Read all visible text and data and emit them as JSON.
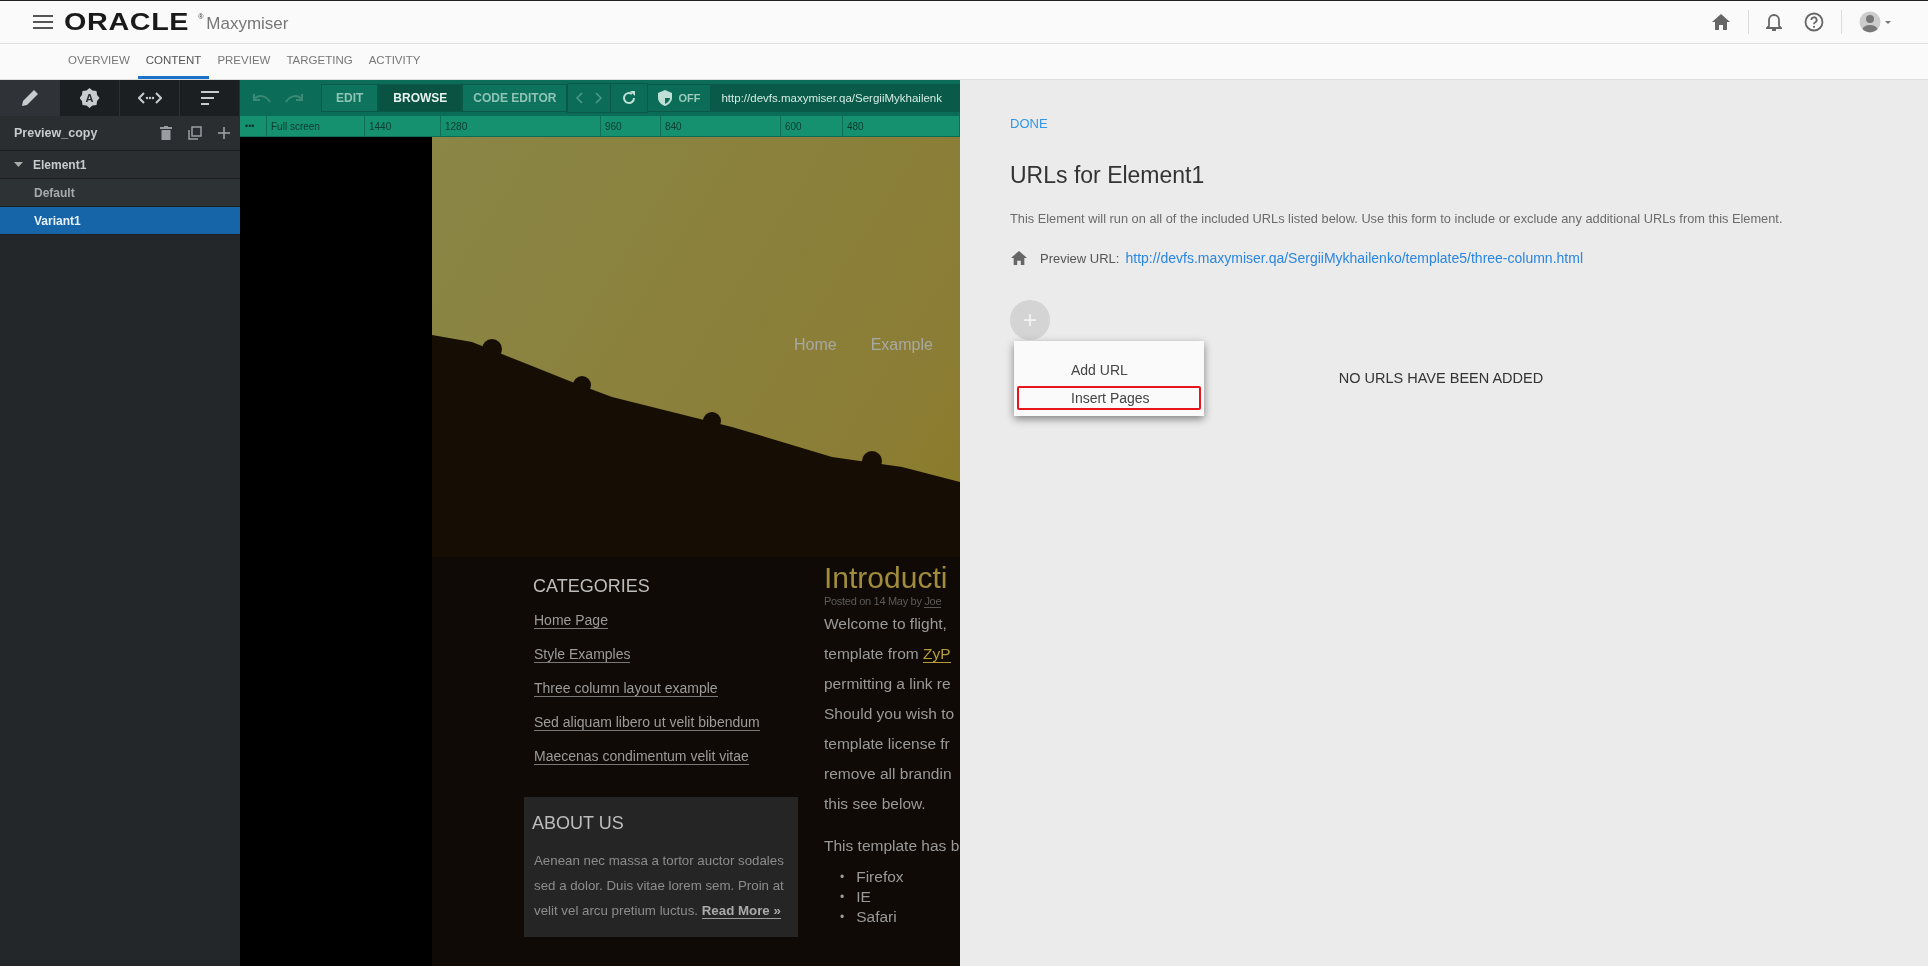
{
  "header": {
    "logo": "ORACLE",
    "logo_mark": "®",
    "product": "Maxymiser"
  },
  "nav_tabs": [
    {
      "label": "OVERVIEW",
      "selected": false
    },
    {
      "label": "CONTENT",
      "selected": true
    },
    {
      "label": "PREVIEW",
      "selected": false
    },
    {
      "label": "TARGETING",
      "selected": false
    },
    {
      "label": "ACTIVITY",
      "selected": false
    }
  ],
  "sidebar": {
    "tabs": [
      {
        "kind": "pencil",
        "selected": true
      },
      {
        "kind": "badge",
        "glyph": "A",
        "selected": false
      },
      {
        "kind": "code",
        "selected": false
      },
      {
        "kind": "sort",
        "selected": false
      }
    ],
    "variation": "Preview_copy",
    "tree": [
      {
        "label": "Element1",
        "expanded": true,
        "selected": false,
        "children": [
          {
            "label": "Default",
            "selected": false
          },
          {
            "label": "Variant1",
            "selected": true
          }
        ]
      }
    ]
  },
  "toolbar": {
    "history": [
      {
        "kind": "undo",
        "disabled": true
      },
      {
        "kind": "redo",
        "disabled": true
      }
    ],
    "modes": [
      {
        "label": "EDIT",
        "selected": false
      },
      {
        "label": "BROWSE",
        "selected": true
      },
      {
        "label": "CODE EDITOR",
        "selected": false
      }
    ],
    "proxy": "OFF",
    "url": "http://devfs.maxymiser.qa/SergiiMykhailenk"
  },
  "ruler": {
    "more": "•••",
    "labels": [
      "Full screen",
      "1440",
      "1280",
      "960",
      "840",
      "600",
      "480"
    ]
  },
  "preview_page": {
    "nav": [
      "Home",
      "Example"
    ],
    "categories": {
      "title": "CATEGORIES",
      "links": [
        "Home Page",
        "Style Examples",
        "Three column layout example",
        "Sed aliquam libero ut velit bibendum",
        "Maecenas condimentum velit vitae"
      ]
    },
    "about": {
      "title": "ABOUT US",
      "text": "Aenean nec massa a tortor auctor sodales sed a dolor. Duis vitae lorem sem. Proin at velit vel arcu pretium luctus.",
      "link": "Read More »"
    },
    "article": {
      "title": "Introducti",
      "byline": "Posted on 14 May by",
      "author": "Joe",
      "lines": [
        {
          "text": "Welcome to flight,"
        },
        {
          "text": "template from ",
          "link": "ZyP"
        },
        {
          "text": "permitting a link re"
        },
        {
          "text": "Should you wish to"
        },
        {
          "text": "template license fr"
        },
        {
          "text": "remove all brandin"
        },
        {
          "text": "this see below."
        }
      ],
      "intro2": "This template has b",
      "marker": "•",
      "bullets": [
        "Firefox",
        "IE",
        "Safari"
      ]
    }
  },
  "panel": {
    "done": "DONE",
    "title": "URLs for Element1",
    "description": "This Element will run on all of the included URLs listed below. Use this form to include or exclude any additional URLs from this Element.",
    "preview_label": "Preview URL:",
    "preview_url": "http://devfs.maxymiser.qa/SergiiMykhailenko/template5/three-column.html",
    "add": "+",
    "menu": [
      {
        "label": "Add URL",
        "highlighted": false
      },
      {
        "label": "Insert Pages",
        "highlighted": true
      }
    ],
    "empty": "NO URLS HAVE BEEN ADDED"
  }
}
